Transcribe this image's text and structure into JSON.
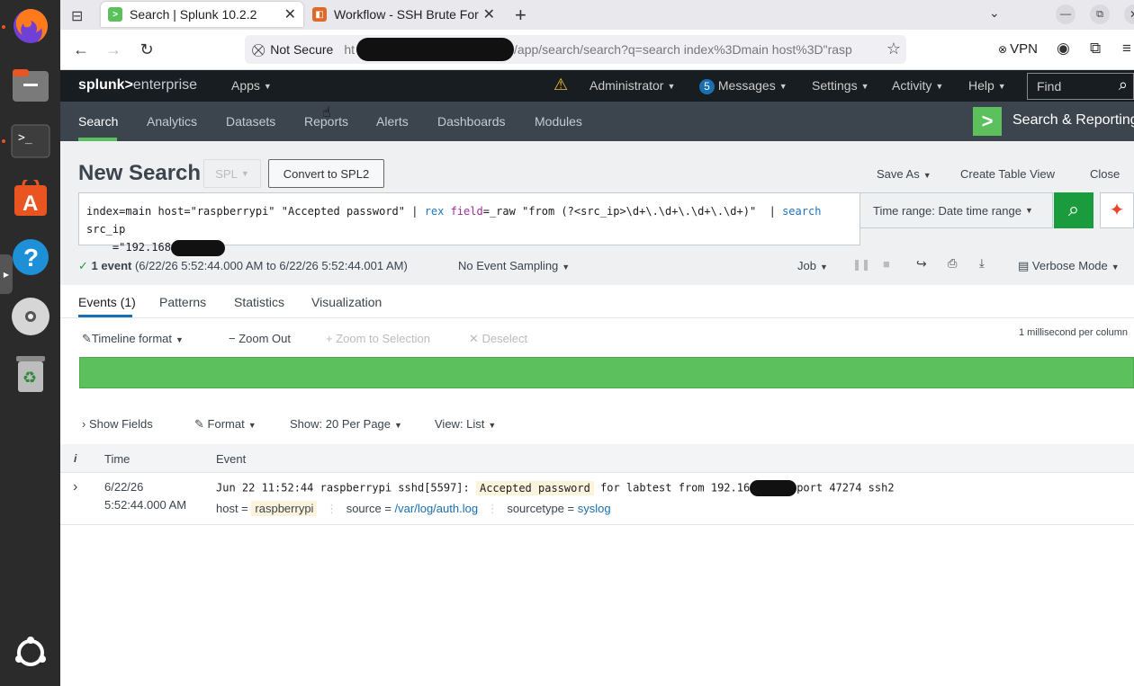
{
  "browser": {
    "tabs": [
      {
        "label": "Search | Splunk 10.2.2",
        "active": true
      },
      {
        "label": "Workflow - SSH Brute For",
        "active": false
      }
    ],
    "url": {
      "security_label": "Not Secure",
      "prefix": "ht",
      "path": "/app/search/search?q=search index%3Dmain host%3D\"rasp"
    },
    "vpn_label": "VPN"
  },
  "splunk": {
    "logo_left": "splunk>",
    "logo_right": "enterprise",
    "top_nav": {
      "apps": "Apps",
      "user": "Administrator",
      "messages_count": "5",
      "messages": "Messages",
      "settings": "Settings",
      "activity": "Activity",
      "help": "Help",
      "find_placeholder": "Find"
    },
    "app_nav": {
      "items": [
        "Search",
        "Analytics",
        "Datasets",
        "Reports",
        "Alerts",
        "Dashboards",
        "Modules"
      ],
      "app_title": "Search & Reporting"
    },
    "search": {
      "title": "New Search",
      "spl_label": "SPL",
      "convert_label": "Convert to SPL2",
      "save_as": "Save As",
      "create_table_view": "Create Table View",
      "close": "Close",
      "query_part1": "index=main host=\"raspberrypi\" \"Accepted password\" | ",
      "query_rex": "rex",
      "query_field": "field",
      "query_part2": "=_raw \"from (?<src_ip>\\d+\\.\\d+\\.\\d+\\.\\d+)\"  | ",
      "query_search": "search",
      "query_part3": " src_ip\n    =\"192.168",
      "time_range": "Time range: Date time range"
    },
    "status": {
      "events": "1 event",
      "range": "(6/22/26 5:52:44.000 AM to 6/22/26 5:52:44.001 AM)",
      "sampling": "No Event Sampling",
      "job": "Job",
      "mode": "Verbose Mode"
    },
    "result_tabs": [
      "Events (1)",
      "Patterns",
      "Statistics",
      "Visualization"
    ],
    "timeline": {
      "format": "Timeline format",
      "zoom_out": "Zoom Out",
      "zoom_selection": "Zoom to Selection",
      "deselect": "Deselect",
      "scale": "1 millisecond per column"
    },
    "list_controls": {
      "show_fields": "Show Fields",
      "format": "Format",
      "per_page": "Show: 20 Per Page",
      "view": "View: List"
    },
    "table": {
      "headers": {
        "info": "i",
        "time": "Time",
        "event": "Event"
      },
      "row": {
        "date": "6/22/26",
        "time": "5:52:44.000 AM",
        "event_pre": "Jun 22 11:52:44 raspberrypi sshd[5597]: ",
        "event_highlight": "Accepted password",
        "event_mid": " for labtest from 192.16",
        "event_post": "port 47274 ssh2",
        "host_label": "host =",
        "host_value": "raspberrypi",
        "source_label": "source =",
        "source_value": "/var/log/auth.log",
        "sourcetype_label": "sourcetype =",
        "sourcetype_value": "syslog"
      }
    }
  },
  "colors": {
    "splunk_green": "#5cc05c",
    "search_button": "#1a9c3e",
    "dock_bg": "#2b2b2b",
    "ubuntu_orange": "#e95420"
  }
}
